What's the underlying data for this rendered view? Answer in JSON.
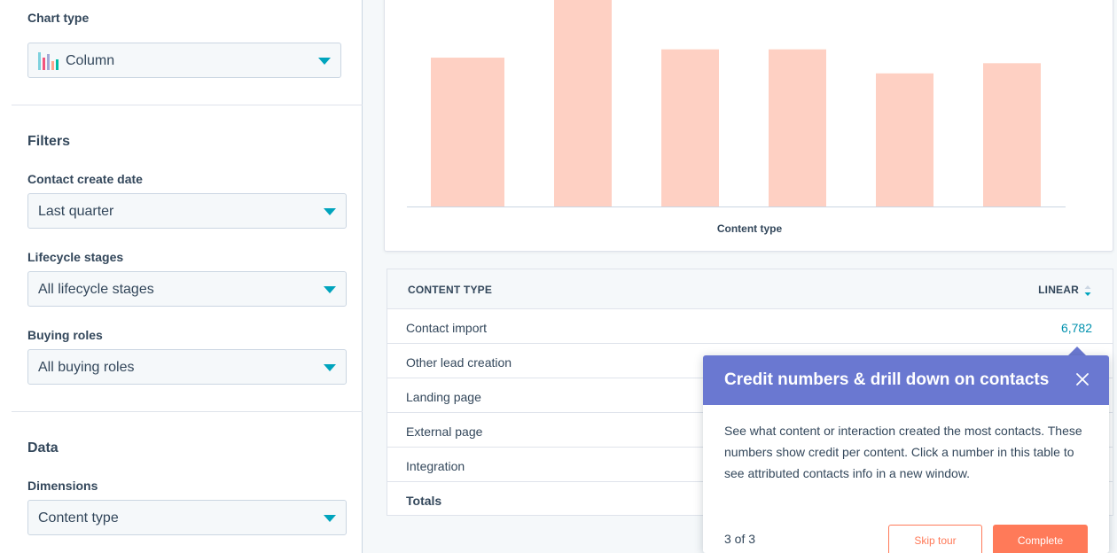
{
  "sidebar": {
    "chart_type_label": "Chart type",
    "chart_type_value": "Column",
    "filters_title": "Filters",
    "contact_create_date_label": "Contact create date",
    "contact_create_date_value": "Last quarter",
    "lifecycle_label": "Lifecycle stages",
    "lifecycle_value": "All lifecycle stages",
    "buying_roles_label": "Buying roles",
    "buying_roles_value": "All buying roles",
    "data_title": "Data",
    "dimensions_label": "Dimensions",
    "dimensions_value": "Content type"
  },
  "chart_data": {
    "type": "bar",
    "xlabel": "Content type",
    "bar_color": "#fed0c3",
    "values": [
      161,
      245,
      170,
      170,
      144,
      155
    ],
    "ylim": [
      0,
      232
    ]
  },
  "table": {
    "col_content_type": "CONTENT TYPE",
    "col_linear": "LINEAR",
    "rows": [
      {
        "name": "Contact import",
        "value": "6,782"
      },
      {
        "name": "Other lead creation",
        "value": ""
      },
      {
        "name": "Landing page",
        "value": ""
      },
      {
        "name": "External page",
        "value": ""
      },
      {
        "name": "Integration",
        "value": ""
      },
      {
        "name": "Totals",
        "value": ""
      }
    ]
  },
  "tour": {
    "title": "Credit numbers & drill down on contacts",
    "body": "See what content or interaction created the most contacts. These numbers show credit per content. Click a number in this table to see attributed contacts info in a new window.",
    "step": "3 of 3",
    "skip_label": "Skip tour",
    "complete_label": "Complete",
    "header_color": "#6a78d1",
    "accent_color": "#ff7a59"
  }
}
